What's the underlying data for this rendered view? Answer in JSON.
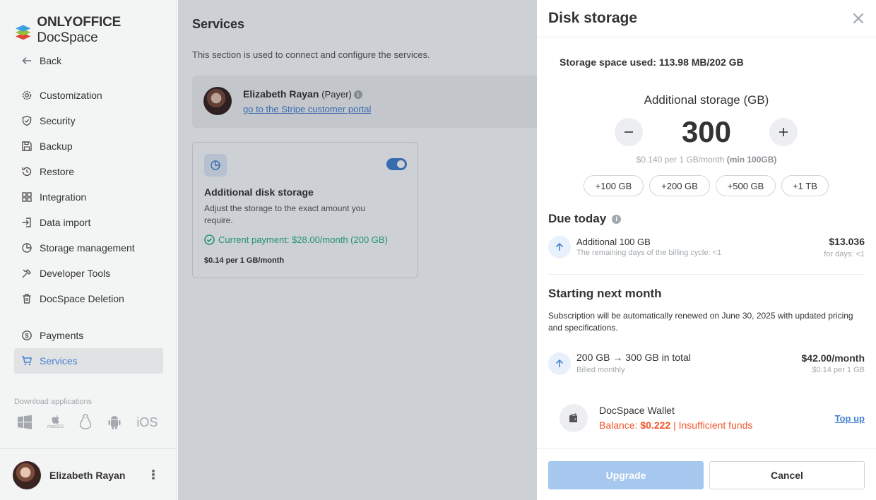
{
  "app": {
    "logo_brand": "ONLYOFFICE",
    "logo_product": "DocSpace"
  },
  "sidebar": {
    "back_label": "Back",
    "items": [
      {
        "label": "Customization",
        "icon": "gear-icon"
      },
      {
        "label": "Security",
        "icon": "shield-icon"
      },
      {
        "label": "Backup",
        "icon": "floppy-icon"
      },
      {
        "label": "Restore",
        "icon": "history-icon"
      },
      {
        "label": "Integration",
        "icon": "grid-icon"
      },
      {
        "label": "Data import",
        "icon": "import-icon"
      },
      {
        "label": "Storage management",
        "icon": "pie-icon"
      },
      {
        "label": "Developer Tools",
        "icon": "tools-icon"
      },
      {
        "label": "DocSpace Deletion",
        "icon": "trash-icon"
      },
      {
        "label": "Payments",
        "icon": "dollar-icon"
      },
      {
        "label": "Services",
        "icon": "cart-icon",
        "active": true
      }
    ],
    "download_label": "Download applications",
    "download_icons": [
      "windows-icon",
      "macos-icon",
      "linux-icon",
      "android-icon",
      "ios-icon"
    ],
    "macos_label": "macOS",
    "ios_label": "iOS",
    "profile_name": "Elizabeth Rayan"
  },
  "main": {
    "title": "Services",
    "description": "This section is used to connect and configure the services.",
    "payer": {
      "name": "Elizabeth Rayan",
      "role": "(Payer)",
      "link": "go to the Stripe customer portal"
    },
    "service_card": {
      "title": "Additional disk storage",
      "description": "Adjust the storage to the exact amount you require.",
      "current_payment": "Current payment: $28.00/month (200 GB)",
      "price": "$0.14 per 1 GB/month",
      "enabled": true
    }
  },
  "panel": {
    "title": "Disk storage",
    "storage_used": "Storage space used: 113.98 MB/202 GB",
    "additional_title": "Additional storage (GB)",
    "stepper_value": "300",
    "rate_text": "$0.140 per 1 GB/month",
    "rate_min": "(min 100GB)",
    "chips": [
      "+100 GB",
      "+200 GB",
      "+500 GB",
      "+1 TB"
    ],
    "due_today": {
      "title": "Due today",
      "item_title": "Additional 100 GB",
      "item_sub": "The remaining days of the billing cycle: <1",
      "amount": "$13.036",
      "amount_sub": "for days: <1"
    },
    "next_month": {
      "title": "Starting next month",
      "text": "Subscription will be automatically renewed on June 30, 2025 with updated pricing and specifications.",
      "item_title": "200 GB → 300 GB in total",
      "item_sub": "Billed monthly",
      "amount": "$42.00/month",
      "amount_sub": "$0.14 per 1 GB"
    },
    "wallet": {
      "title": "DocSpace Wallet",
      "balance_label": "Balance:",
      "balance_value": "$0.222",
      "separator": "|",
      "warning": "Insufficient funds",
      "topup": "Top up"
    },
    "upgrade_label": "Upgrade",
    "cancel_label": "Cancel"
  },
  "colors": {
    "accent": "#4781d1",
    "success": "#2db482",
    "danger": "#f2552c",
    "upgrade_disabled": "#a6c7ee"
  }
}
